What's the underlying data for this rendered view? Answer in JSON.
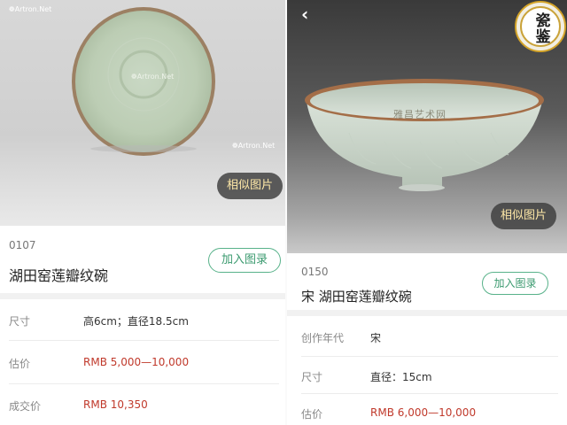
{
  "left": {
    "watermark_top": "Artron.Net",
    "watermark_center": "Artron.Net",
    "watermark_bottom": "Artron.Net",
    "similar_button": "相似图片",
    "lot_number": "0107",
    "title": "湖田窑莲瓣纹碗",
    "add_button": "加入图录",
    "rows": [
      {
        "key": "尺寸",
        "value": "高6cm；直径18.5cm"
      },
      {
        "key": "估价",
        "value": "RMB 5,000—10,000"
      },
      {
        "key": "成交价",
        "value": "RMB 10,350"
      }
    ]
  },
  "right": {
    "back_icon": "chevron-left-icon",
    "seal_text": "瓷鉴",
    "image_watermark": "雅昌艺术网",
    "similar_button": "相似图片",
    "lot_number": "0150",
    "title": "宋 湖田窑莲瓣纹碗",
    "add_button": "加入图录",
    "rows": [
      {
        "key": "创作年代",
        "value": "宋"
      },
      {
        "key": "尺寸",
        "value": "直径：15cm"
      },
      {
        "key": "估价",
        "value": "RMB 6,000—10,000"
      }
    ]
  },
  "colors": {
    "accent_green": "#3b9a6f",
    "price_red": "#c0392b",
    "similar_text": "#ffe9a8"
  }
}
